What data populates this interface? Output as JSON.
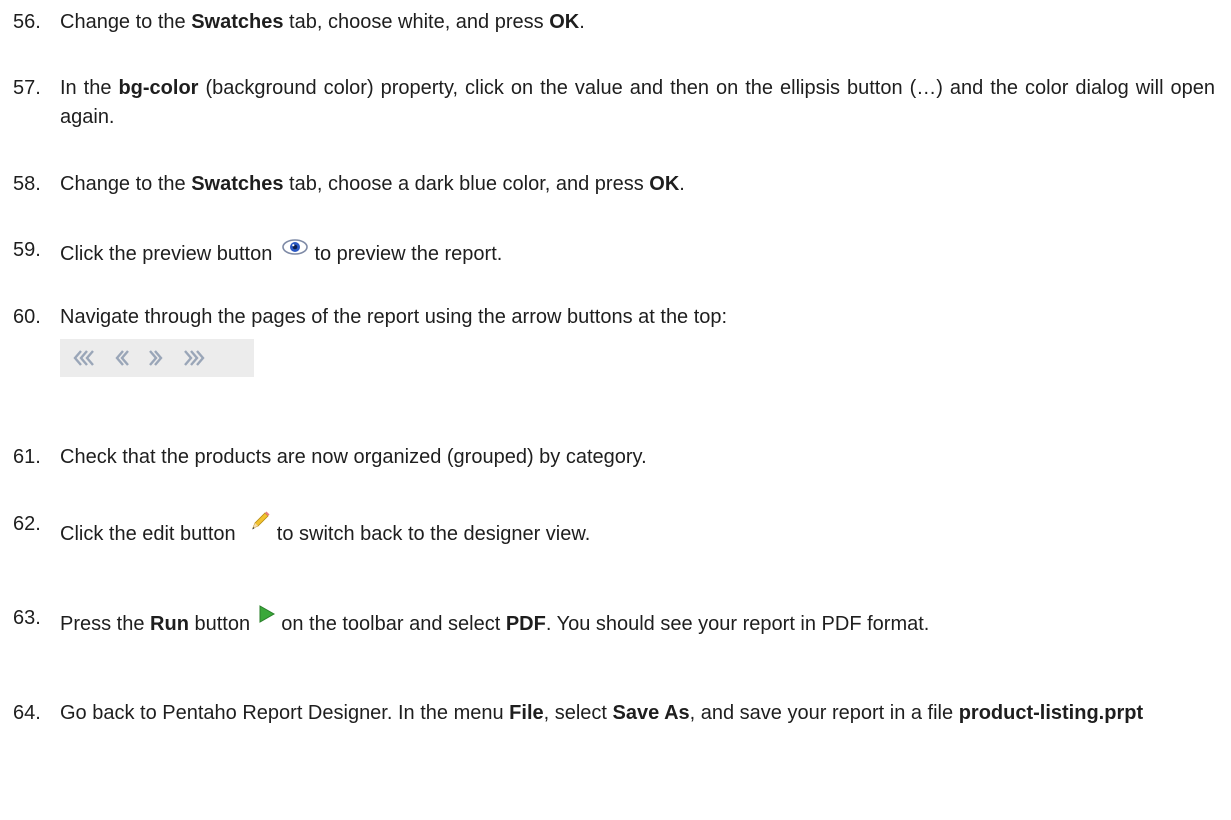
{
  "steps": [
    {
      "num": "56.",
      "parts": [
        {
          "t": "Change to the "
        },
        {
          "t": "Swatches",
          "b": true
        },
        {
          "t": " tab, choose white, and press "
        },
        {
          "t": "OK",
          "b": true
        },
        {
          "t": "."
        }
      ]
    },
    {
      "num": "57.",
      "parts": [
        {
          "t": "In the "
        },
        {
          "t": "bg-color",
          "b": true
        },
        {
          "t": " (background color) property, click on the value and then on the ellipsis button (…) and the color dialog will open again."
        }
      ]
    },
    {
      "num": "58.",
      "parts": [
        {
          "t": "Change to the "
        },
        {
          "t": "Swatches",
          "b": true
        },
        {
          "t": " tab, choose a dark blue color, and press "
        },
        {
          "t": "OK",
          "b": true
        },
        {
          "t": "."
        }
      ]
    },
    {
      "num": "59.",
      "a": "Click the preview button",
      "b": " to preview the report."
    },
    {
      "num": "60.",
      "text": "Navigate through the pages of the report using the arrow buttons at the top:"
    },
    {
      "num": "61.",
      "text": "Check that the products are now organized (grouped) by category."
    },
    {
      "num": "62.",
      "a": "Click the edit button",
      "b": " to switch back to the designer view."
    },
    {
      "num": "63.",
      "parts": [
        {
          "t": "Press the "
        },
        {
          "t": "Run",
          "b": true
        },
        {
          "t": " button "
        },
        {
          "icon": "run-icon"
        },
        {
          "t": " on the toolbar and select "
        },
        {
          "t": "PDF",
          "b": true
        },
        {
          "t": ". You should see your report in PDF format."
        }
      ]
    },
    {
      "num": "64.",
      "parts": [
        {
          "t": "Go back to Pentaho Report Designer. In the menu "
        },
        {
          "t": "File",
          "b": true
        },
        {
          "t": ", select "
        },
        {
          "t": "Save As",
          "b": true
        },
        {
          "t": ", and save your report in a file "
        },
        {
          "t": "product-listing.prpt",
          "b": true
        }
      ]
    }
  ],
  "icons": {
    "preview": "eye-icon",
    "edit": "pencil-icon",
    "run": "run-icon",
    "nav": [
      "first-page-icon",
      "previous-page-icon",
      "next-page-icon",
      "last-page-icon"
    ]
  },
  "colors": {
    "text": "#1e1e1e",
    "nav_bg": "#ececec",
    "nav_arrow": "#9aa6b8",
    "run_green": "#3aa83a"
  }
}
